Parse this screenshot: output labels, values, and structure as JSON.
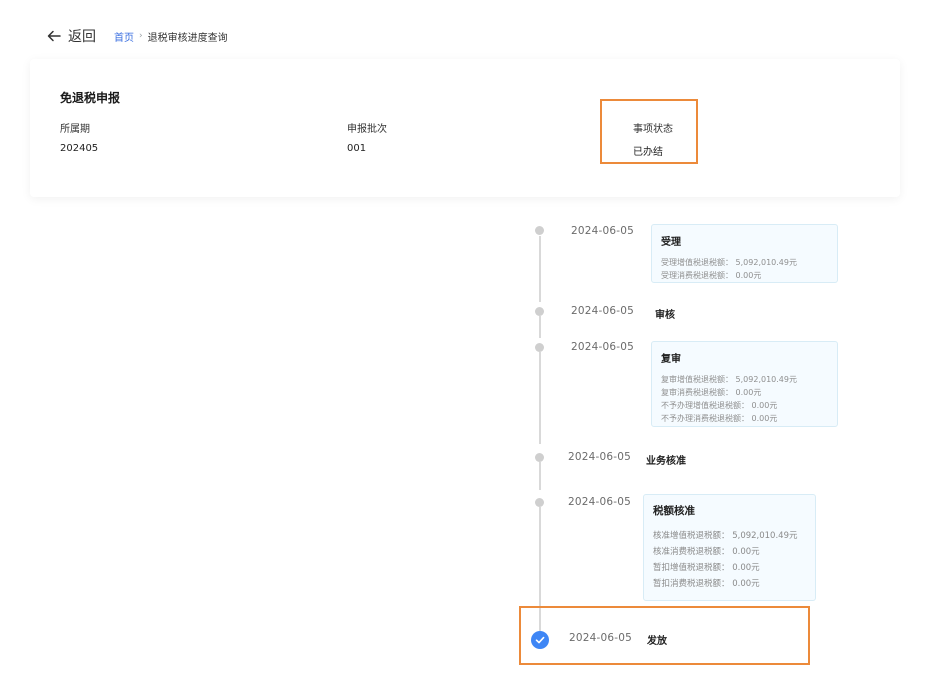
{
  "nav": {
    "back_label": "返回",
    "breadcrumb": {
      "home": "首页",
      "separator": "›",
      "current": "退税审核进度查询"
    }
  },
  "summary": {
    "title": "免退税申报",
    "fields": [
      {
        "label": "所属期",
        "value": "202405"
      },
      {
        "label": "申报批次",
        "value": "001"
      },
      {
        "label": "事项状态",
        "value": "已办结"
      }
    ]
  },
  "timeline": [
    {
      "date": "2024-06-05",
      "title": "受理",
      "lines": [
        "受理增值税退税额： 5,092,010.49元",
        "受理消费税退税额： 0.00元"
      ]
    },
    {
      "date": "2024-06-05",
      "title": "审核",
      "lines": []
    },
    {
      "date": "2024-06-05",
      "title": "复审",
      "lines": [
        "复审增值税退税额： 5,092,010.49元",
        "复审消费税退税额： 0.00元",
        "不予办理增值税退税额： 0.00元",
        "不予办理消费税退税额： 0.00元"
      ]
    },
    {
      "date": "2024-06-05",
      "title": "业务核准",
      "lines": []
    },
    {
      "date": "2024-06-05",
      "title": "税额核准",
      "lines": [
        "核准增值税退税额： 5,092,010.49元",
        "核准消费税退税额： 0.00元",
        "暂扣增值税退税额： 0.00元",
        "暂扣消费税退税额： 0.00元"
      ]
    },
    {
      "date": "2024-06-05",
      "title": "发放",
      "lines": []
    }
  ],
  "colors": {
    "accent": "#3e86f5",
    "link": "#3b6fe0",
    "highlight": "#ec8a3a"
  },
  "icons": {
    "back": "arrow-left-icon",
    "done": "check-circle-icon"
  }
}
